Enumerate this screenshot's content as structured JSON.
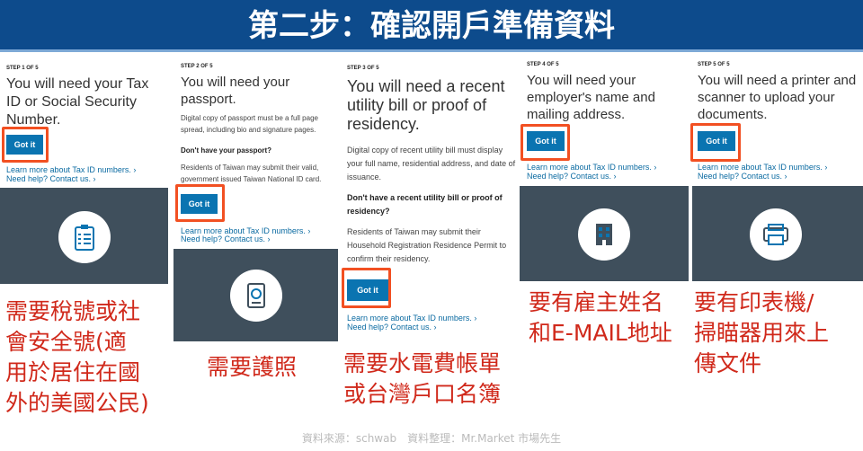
{
  "title": "第二步：確認開戶準備資料",
  "steps": [
    {
      "step": "STEP 1 OF 5",
      "title": "You will need your Tax ID or Social Security Number.",
      "button": "Got it",
      "link1": "Learn more about Tax ID numbers. ›",
      "link2": "Need help? Contact us. ›",
      "icon": "clipboard-checklist-icon",
      "caption": "需要稅號或社\n會安全號(適\n用於居住在國\n外的美國公民)"
    },
    {
      "step": "STEP 2 OF 5",
      "title": "You will need your passport.",
      "body": "Digital copy of passport must be a full page spread, including bio and signature pages.",
      "question": "Don't have your passport?",
      "body2": "Residents of Taiwan may submit their valid, government issued Taiwan National ID card.",
      "button": "Got it",
      "link1": "Learn more about Tax ID numbers. ›",
      "link2": "Need help? Contact us. ›",
      "icon": "passport-icon",
      "caption": "需要護照"
    },
    {
      "step": "STEP 3 OF 5",
      "title": "You will need a recent utility bill or proof of residency.",
      "body": "Digital copy of recent utility bill must display your full name, residential address, and date of issuance.",
      "question": "Don't have a recent utility bill or proof of residency?",
      "body2": "Residents of Taiwan may submit their Household Registration Residence Permit to confirm their residency.",
      "button": "Got it",
      "link1": "Learn more about Tax ID numbers. ›",
      "link2": "Need help? Contact us. ›",
      "caption": "需要水電費帳單\n或台灣戶口名簿"
    },
    {
      "step": "STEP 4 OF 5",
      "title": "You will need your employer's name and mailing address.",
      "button": "Got it",
      "link1": "Learn more about Tax ID numbers. ›",
      "link2": "Need help? Contact us. ›",
      "icon": "building-icon",
      "caption": "要有雇主姓名\n和E-MAIL地址"
    },
    {
      "step": "STEP 5 OF 5",
      "title": "You will need a printer and scanner to upload your documents.",
      "button": "Got it",
      "link1": "Learn more about Tax ID numbers. ›",
      "link2": "Need help? Contact us. ›",
      "icon": "printer-icon",
      "caption": "要有印表機/\n掃瞄器用來上\n傳文件"
    }
  ],
  "footer": "資料來源：schwab　資料整理：Mr.Market 市場先生",
  "colors": {
    "header": "#0d4b8c",
    "button": "#0a74b1",
    "highlight": "#f25022",
    "caption": "#d0291b",
    "panel": "#3f4f5c"
  }
}
